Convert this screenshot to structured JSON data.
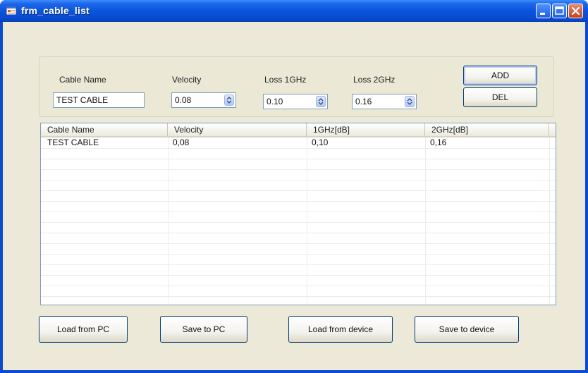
{
  "window": {
    "title": "frm_cable_list"
  },
  "form": {
    "cable_name": {
      "label": "Cable Name",
      "value": "TEST CABLE"
    },
    "velocity": {
      "label": "Velocity",
      "value": "0.08"
    },
    "loss_1ghz": {
      "label": "Loss 1GHz",
      "value": "0.10"
    },
    "loss_2ghz": {
      "label": "Loss 2GHz",
      "value": "0.16"
    },
    "add_label": "ADD",
    "del_label": "DEL"
  },
  "table": {
    "columns": [
      "Cable Name",
      "Velocity",
      "1GHz[dB]",
      "2GHz[dB]"
    ],
    "rows": [
      [
        "TEST CABLE",
        "0,08",
        "0,10",
        "0,16"
      ]
    ]
  },
  "footer": {
    "load_pc": "Load from PC",
    "save_pc": "Save to PC",
    "load_device": "Load from device",
    "save_device": "Save to device"
  },
  "colors": {
    "title_bar": "#0a4bd2",
    "dialog_bg": "#ece9d8",
    "close_button": "#c4401c"
  },
  "icons": [
    "app-icon",
    "minimize-icon",
    "maximize-icon",
    "close-icon",
    "spin-arrows-icon"
  ]
}
